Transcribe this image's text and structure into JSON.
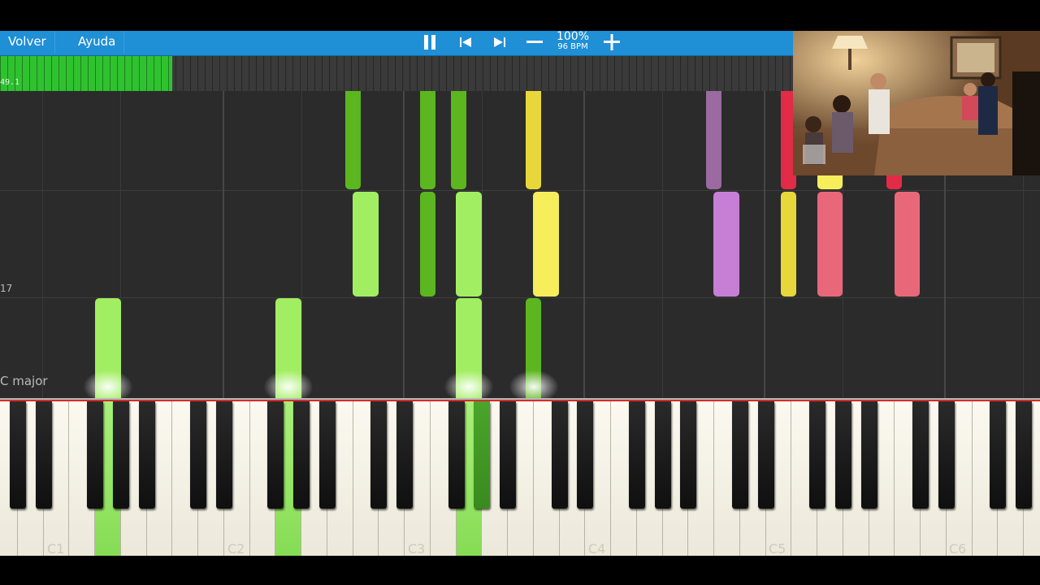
{
  "toolbar": {
    "back_label": "Volver",
    "help_label": "Ayuda",
    "tempo_percent": "100%",
    "tempo_bpm": "96 BPM"
  },
  "progress": {
    "label": "49.1",
    "fraction": 0.217
  },
  "roll": {
    "measure_number": "17",
    "key_signature": "C major"
  },
  "keyboard": {
    "octave_labels": [
      "C1",
      "C2",
      "C3",
      "C4",
      "C5",
      "C6"
    ]
  },
  "icons": {
    "pause": "pause-icon",
    "previous": "skip-previous-icon",
    "next": "skip-next-icon",
    "slower": "minus-icon",
    "faster": "plus-icon"
  },
  "colors": {
    "toolbar": "#1f8fd6",
    "progress": "#2fc22f",
    "note_light_green": "#a2ee62",
    "note_dark_green": "#5cb61f",
    "note_yellow": "#f6ee5a",
    "note_purple": "#c77fd6",
    "note_pink": "#e8687a",
    "note_red": "#e22b46"
  }
}
